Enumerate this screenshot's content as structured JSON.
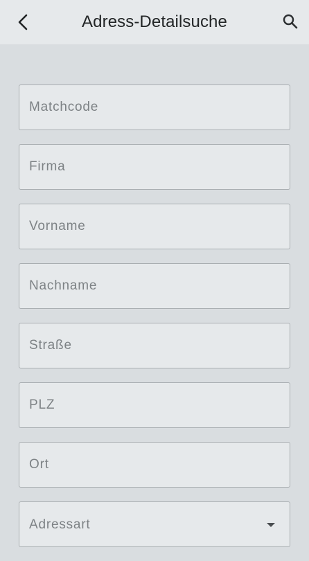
{
  "appbar": {
    "title": "Adress-Detailsuche",
    "back_icon": "chevron-left-icon",
    "search_icon": "search-icon",
    "background": "#e6e9eb"
  },
  "form": {
    "fields": [
      {
        "placeholder": "Matchcode",
        "value": ""
      },
      {
        "placeholder": "Firma",
        "value": ""
      },
      {
        "placeholder": "Vorname",
        "value": ""
      },
      {
        "placeholder": "Nachname",
        "value": ""
      },
      {
        "placeholder": "Straße",
        "value": ""
      },
      {
        "placeholder": "PLZ",
        "value": ""
      },
      {
        "placeholder": "Ort",
        "value": ""
      }
    ],
    "adressart": {
      "label": "Adressart",
      "icon": "dropdown-arrow-icon"
    }
  },
  "colors": {
    "page_background": "#d9dde0",
    "field_background": "#e6e9eb",
    "field_border": "#a9aeb1",
    "placeholder_text": "#7d8285"
  }
}
